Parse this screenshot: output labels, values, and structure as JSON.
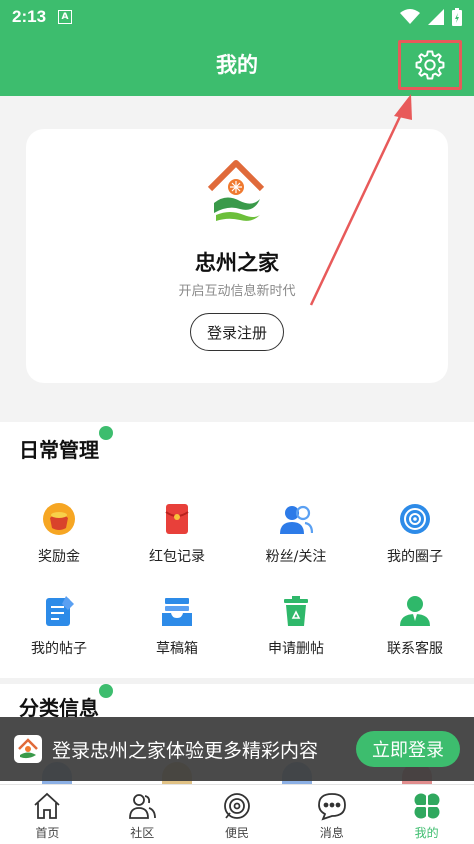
{
  "status_bar": {
    "time": "2:13",
    "notification": "A"
  },
  "header": {
    "title": "我的"
  },
  "profile": {
    "app_name": "忠州之家",
    "slogan": "开启互动信息新时代",
    "login_button": "登录注册"
  },
  "daily": {
    "title": "日常管理",
    "items": [
      {
        "label": "奖励金",
        "icon": "reward-icon"
      },
      {
        "label": "红包记录",
        "icon": "red-envelope-icon"
      },
      {
        "label": "粉丝/关注",
        "icon": "followers-icon"
      },
      {
        "label": "我的圈子",
        "icon": "circle-target-icon"
      },
      {
        "label": "我的帖子",
        "icon": "post-edit-icon"
      },
      {
        "label": "草稿箱",
        "icon": "drafts-tray-icon"
      },
      {
        "label": "申请删帖",
        "icon": "delete-bin-icon"
      },
      {
        "label": "联系客服",
        "icon": "customer-service-icon"
      }
    ]
  },
  "category": {
    "title": "分类信息"
  },
  "banner": {
    "text": "登录忠州之家体验更多精彩内容",
    "button": "立即登录"
  },
  "tabs": [
    {
      "label": "首页",
      "icon": "home-icon"
    },
    {
      "label": "社区",
      "icon": "community-icon"
    },
    {
      "label": "便民",
      "icon": "convenience-icon"
    },
    {
      "label": "消息",
      "icon": "message-icon"
    },
    {
      "label": "我的",
      "icon": "clover-icon",
      "active": true
    }
  ],
  "colors": {
    "brand": "#3dbd6e",
    "annotation": "#e85a5a"
  }
}
